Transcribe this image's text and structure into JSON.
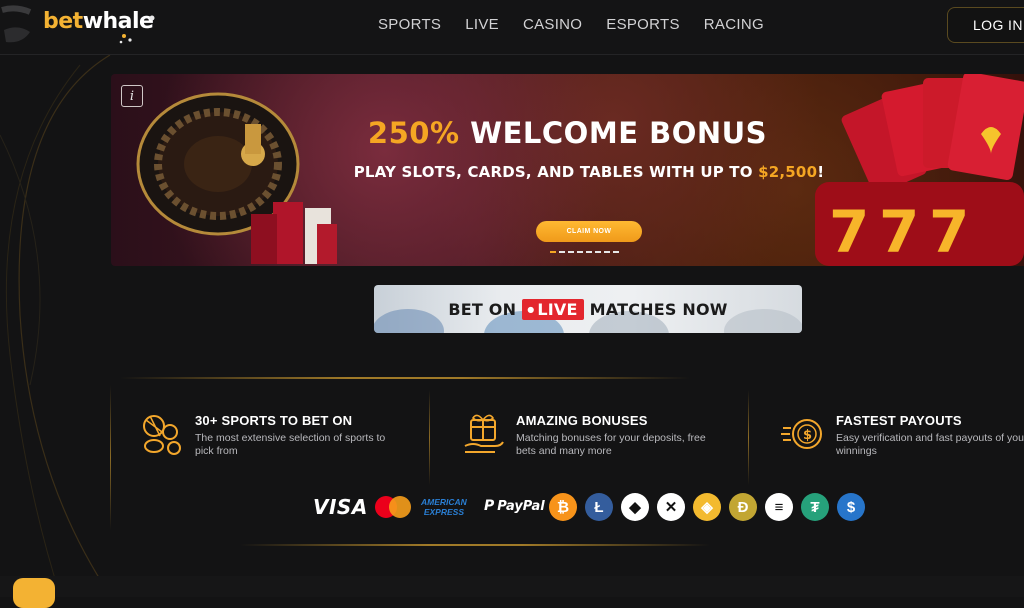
{
  "header": {
    "logo_bet": "bet",
    "logo_whale": "whale",
    "nav": [
      "SPORTS",
      "LIVE",
      "CASINO",
      "ESPORTS",
      "RACING"
    ],
    "login_label": "LOG IN"
  },
  "banner": {
    "title_pct": "250%",
    "title_rest": "WELCOME BONUS",
    "subtitle_pre": "PLAY SLOTS, CARDS, AND TABLES WITH UP TO ",
    "subtitle_amount": "$2,500",
    "subtitle_post": "!",
    "cta_label": "CLAIM NOW",
    "slide_count": 8,
    "active_slide": 1
  },
  "live_banner": {
    "pre": "BET ON",
    "badge": "LIVE",
    "post": "MATCHES NOW"
  },
  "features": [
    {
      "icon": "sports-balls-icon",
      "title": "30+ SPORTS TO BET ON",
      "desc": "The most extensive selection of sports to pick from"
    },
    {
      "icon": "gift-hand-icon",
      "title": "AMAZING BONUSES",
      "desc": "Matching bonuses for your deposits, free bets and many more"
    },
    {
      "icon": "coin-fast-icon",
      "title": "FASTEST PAYOUTS",
      "desc": "Easy verification and fast payouts of your winnings"
    }
  ],
  "payments": {
    "visa": "VISA",
    "amex_top": "AMERICAN",
    "amex_bottom": "EXPRESS",
    "paypal": "PayPal",
    "coins": [
      {
        "name": "bitcoin-icon",
        "glyph": "₿",
        "color": "#f7931a"
      },
      {
        "name": "litecoin-icon",
        "glyph": "Ł",
        "color": "#345d9d"
      },
      {
        "name": "ethereum-icon",
        "glyph": "◆",
        "color": "#ffffff"
      },
      {
        "name": "xrp-icon",
        "glyph": "✕",
        "color": "#ffffff"
      },
      {
        "name": "bnb-icon",
        "glyph": "◈",
        "color": "#f3ba2f"
      },
      {
        "name": "dogecoin-icon",
        "glyph": "Ð",
        "color": "#c2a633"
      },
      {
        "name": "solana-icon",
        "glyph": "≡",
        "color": "#ffffff"
      },
      {
        "name": "tether-icon",
        "glyph": "₮",
        "color": "#26a17b"
      },
      {
        "name": "usdc-icon",
        "glyph": "$",
        "color": "#2775ca"
      }
    ]
  }
}
